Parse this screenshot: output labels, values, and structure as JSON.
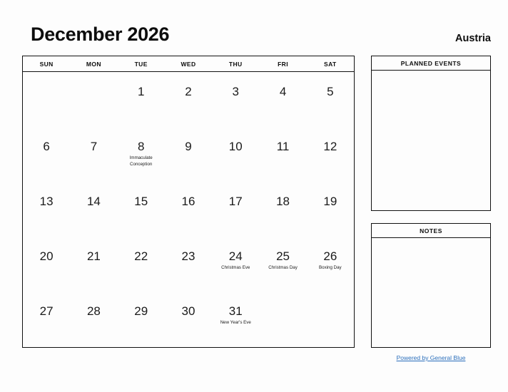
{
  "header": {
    "title": "December 2026",
    "country": "Austria"
  },
  "calendar": {
    "day_headers": [
      "SUN",
      "MON",
      "TUE",
      "WED",
      "THU",
      "FRI",
      "SAT"
    ],
    "weeks": [
      [
        {
          "day": "",
          "event": ""
        },
        {
          "day": "",
          "event": ""
        },
        {
          "day": "1",
          "event": ""
        },
        {
          "day": "2",
          "event": ""
        },
        {
          "day": "3",
          "event": ""
        },
        {
          "day": "4",
          "event": ""
        },
        {
          "day": "5",
          "event": ""
        }
      ],
      [
        {
          "day": "6",
          "event": ""
        },
        {
          "day": "7",
          "event": ""
        },
        {
          "day": "8",
          "event": "Immaculate Conception"
        },
        {
          "day": "9",
          "event": ""
        },
        {
          "day": "10",
          "event": ""
        },
        {
          "day": "11",
          "event": ""
        },
        {
          "day": "12",
          "event": ""
        }
      ],
      [
        {
          "day": "13",
          "event": ""
        },
        {
          "day": "14",
          "event": ""
        },
        {
          "day": "15",
          "event": ""
        },
        {
          "day": "16",
          "event": ""
        },
        {
          "day": "17",
          "event": ""
        },
        {
          "day": "18",
          "event": ""
        },
        {
          "day": "19",
          "event": ""
        }
      ],
      [
        {
          "day": "20",
          "event": ""
        },
        {
          "day": "21",
          "event": ""
        },
        {
          "day": "22",
          "event": ""
        },
        {
          "day": "23",
          "event": ""
        },
        {
          "day": "24",
          "event": "Christmas Eve"
        },
        {
          "day": "25",
          "event": "Christmas Day"
        },
        {
          "day": "26",
          "event": "Boxing Day"
        }
      ],
      [
        {
          "day": "27",
          "event": ""
        },
        {
          "day": "28",
          "event": ""
        },
        {
          "day": "29",
          "event": ""
        },
        {
          "day": "30",
          "event": ""
        },
        {
          "day": "31",
          "event": "New Year's Eve"
        },
        {
          "day": "",
          "event": ""
        },
        {
          "day": "",
          "event": ""
        }
      ]
    ]
  },
  "panels": {
    "planned_events": {
      "title": "PLANNED EVENTS"
    },
    "notes": {
      "title": "NOTES"
    }
  },
  "footer": {
    "link_text": "Powered by General Blue",
    "link_color": "#2a6ebb"
  }
}
